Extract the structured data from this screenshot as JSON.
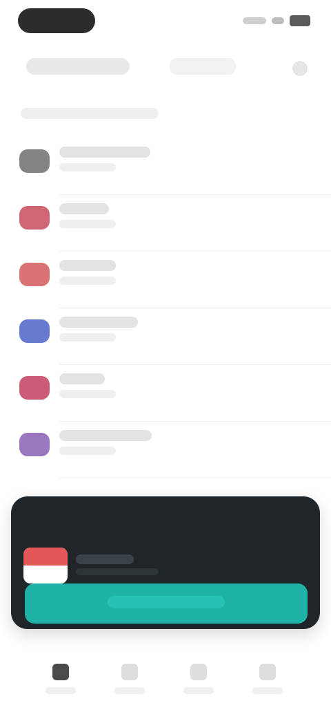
{
  "status_bar": {
    "time": "",
    "right_icons": [
      "signal-icon",
      "wifi-icon",
      "battery-icon"
    ]
  },
  "tabs": {
    "active_label": "",
    "inactive_label": "",
    "right_icon": "search-icon"
  },
  "section_label": "",
  "list": {
    "rows": [
      {
        "title": "",
        "subtitle": "",
        "badge_color": "#6f6f6f"
      },
      {
        "title": "",
        "subtitle": "",
        "badge_color": "#c84b5a"
      },
      {
        "title": "",
        "subtitle": "",
        "badge_color": "#d35b5b"
      },
      {
        "title": "",
        "subtitle": "",
        "badge_color": "#4c63c8"
      },
      {
        "title": "",
        "subtitle": "",
        "badge_color": "#c23f60"
      },
      {
        "title": "",
        "subtitle": "",
        "badge_color": "#8a5fb4"
      }
    ]
  },
  "mini_player": {
    "title": "",
    "subtitle": "",
    "cta_label": ""
  },
  "bottom_nav": {
    "items": [
      {
        "label": "",
        "icon": "home-icon",
        "active": true
      },
      {
        "label": "",
        "icon": "browse-icon",
        "active": false
      },
      {
        "label": "",
        "icon": "library-icon",
        "active": false
      },
      {
        "label": "",
        "icon": "profile-icon",
        "active": false
      }
    ]
  }
}
